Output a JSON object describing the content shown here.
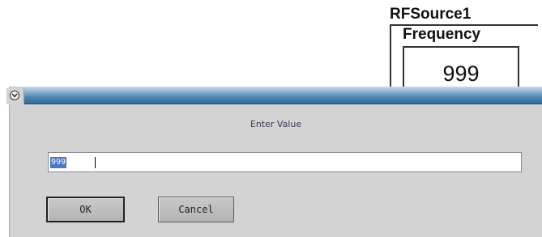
{
  "background_panel": {
    "title": "RFSource1",
    "group_label": "Frequency",
    "value": "999"
  },
  "dialog": {
    "prompt": "Enter Value",
    "input": {
      "value": "999"
    },
    "buttons": {
      "ok_label": "OK",
      "cancel_label": "Cancel"
    }
  },
  "colors": {
    "titlebar_accent": "#2f6d9d",
    "dialog_background": "#d3d3d3",
    "selection": "#4a78c8"
  },
  "icons": {
    "system_menu": "chevron-down-icon"
  }
}
